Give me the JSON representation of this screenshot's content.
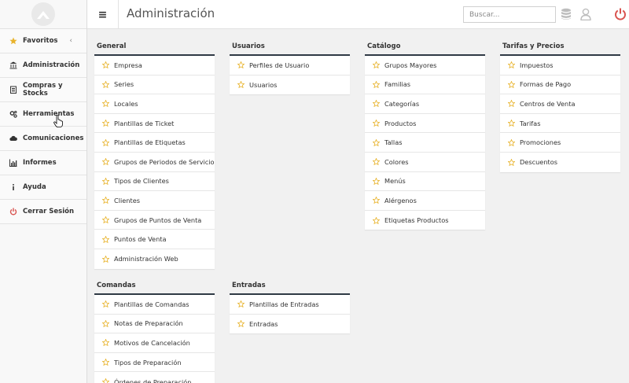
{
  "sidebar": {
    "items": [
      {
        "label": "Favoritos",
        "icon": "star-icon",
        "icon_color": "#e8b32c"
      },
      {
        "label": "Administración",
        "icon": "bank-icon"
      },
      {
        "label": "Compras y Stocks",
        "icon": "clipboard-icon"
      },
      {
        "label": "Herramientas",
        "icon": "gears-icon"
      },
      {
        "label": "Comunicaciones",
        "icon": "cloud-icon"
      },
      {
        "label": "Informes",
        "icon": "bar-chart-icon"
      },
      {
        "label": "Ayuda",
        "icon": "info-icon"
      },
      {
        "label": "Cerrar Sesión",
        "icon": "power-icon",
        "icon_color": "#d9534f"
      }
    ],
    "favoritos_chevron": "‹"
  },
  "header": {
    "menu_icon": "≡",
    "title": "Administración",
    "search_placeholder": "Buscar...",
    "power_color": "#d9534f"
  },
  "panels": [
    {
      "title": "General",
      "items": [
        "Empresa",
        "Series",
        "Locales",
        "Plantillas de Ticket",
        "Plantillas de Etiquetas",
        "Grupos de Periodos de Servicio",
        "Tipos de Clientes",
        "Clientes",
        "Grupos de Puntos de Venta",
        "Puntos de Venta",
        "Administración Web"
      ]
    },
    {
      "title": "Usuarios",
      "items": [
        "Perfiles de Usuario",
        "Usuarios"
      ]
    },
    {
      "title": "Catálogo",
      "items": [
        "Grupos Mayores",
        "Familias",
        "Categorías",
        "Productos",
        "Tallas",
        "Colores",
        "Menús",
        "Alérgenos",
        "Etiquetas Productos"
      ]
    },
    {
      "title": "Tarifas y Precios",
      "items": [
        "Impuestos",
        "Formas de Pago",
        "Centros de Venta",
        "Tarifas",
        "Promociones",
        "Descuentos"
      ]
    },
    {
      "title": "Comandas",
      "items": [
        "Plantillas de Comandas",
        "Notas de Preparación",
        "Motivos de Cancelación",
        "Tipos de Preparación",
        "Órdenes de Preparación"
      ]
    },
    {
      "title": "Entradas",
      "items": [
        "Plantillas de Entradas",
        "Entradas"
      ]
    }
  ],
  "colors": {
    "star": "#e8b32c",
    "panel_border": "#2f3a45"
  }
}
